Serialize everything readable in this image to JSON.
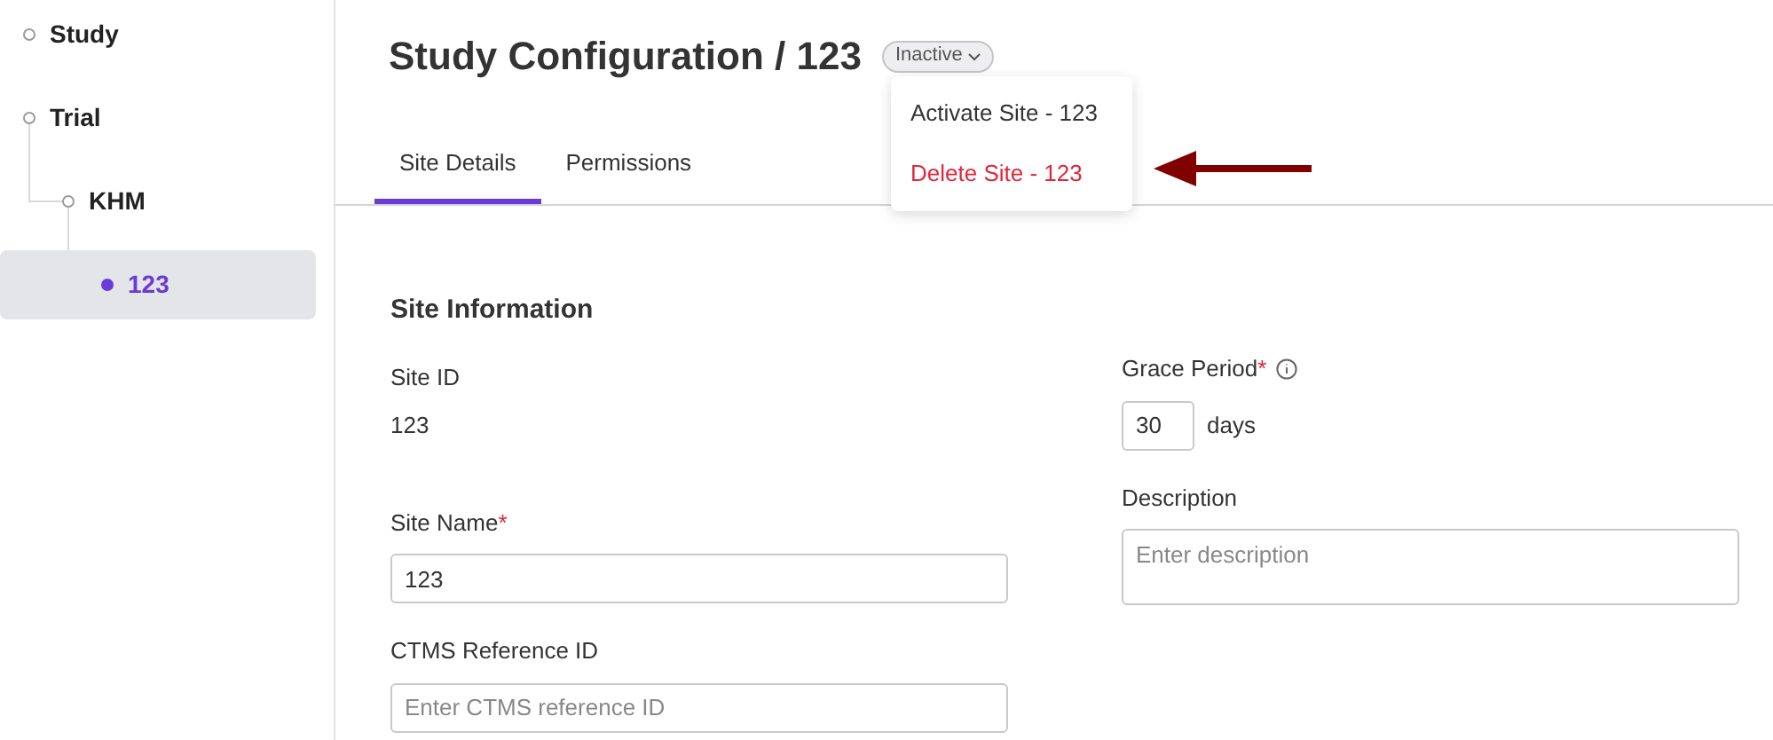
{
  "sidebar": {
    "tree": [
      {
        "label": "Study",
        "selected": false
      },
      {
        "label": "Trial",
        "selected": false,
        "children": [
          {
            "label": "KHM",
            "selected": false,
            "children": [
              {
                "label": "123",
                "selected": true
              }
            ]
          }
        ]
      }
    ]
  },
  "header": {
    "title": "Study Configuration / 123",
    "status": "Inactive"
  },
  "menu": {
    "items": [
      {
        "label": "Activate Site - 123",
        "kind": "default"
      },
      {
        "label": "Delete Site - 123",
        "kind": "danger"
      }
    ]
  },
  "tabs": [
    {
      "label": "Site Details",
      "selected": true
    },
    {
      "label": "Permissions",
      "selected": false
    }
  ],
  "section": {
    "title": "Site Information",
    "left": [
      {
        "label": "Site ID",
        "kind": "text",
        "value": "123"
      },
      {
        "label": "Site Name",
        "kind": "input",
        "required_mark": "*",
        "value": "123"
      },
      {
        "label": "CTMS Reference ID",
        "kind": "input",
        "placeholder": "Enter CTMS reference ID"
      }
    ],
    "right": [
      {
        "label": "Grace Period",
        "kind": "number",
        "required_mark": "*",
        "info": true,
        "value": "30",
        "unit": "days"
      },
      {
        "label": "Description",
        "kind": "textarea",
        "placeholder": "Enter description"
      }
    ]
  }
}
